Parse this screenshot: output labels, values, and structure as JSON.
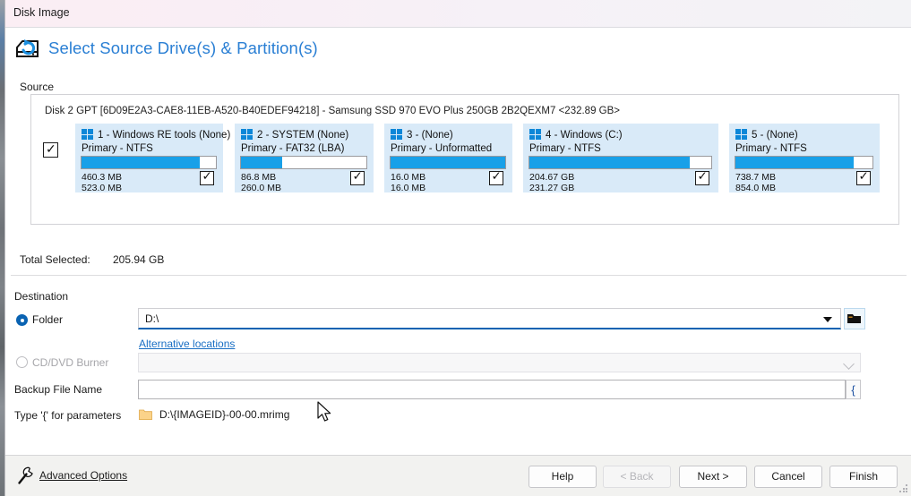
{
  "window": {
    "title": "Disk Image"
  },
  "header": {
    "title": "Select Source Drive(s) & Partition(s)",
    "icon": "disk-image-icon"
  },
  "source": {
    "group_label": "Source",
    "disk_line": "Disk 2 GPT [6D09E2A3-CAE8-11EB-A520-B40EDEF94218] - Samsung SSD 970 EVO Plus 250GB 2B2QEXM7  <232.89 GB>",
    "disk_checked": true,
    "partitions": [
      {
        "title": "1 - Windows RE tools (None)",
        "subtitle": "Primary - NTFS",
        "used": "460.3 MB",
        "total": "523.0 MB",
        "fill_pct": 88,
        "checked": true
      },
      {
        "title": "2 - SYSTEM (None)",
        "subtitle": "Primary - FAT32 (LBA)",
        "used": "86.8 MB",
        "total": "260.0 MB",
        "fill_pct": 33,
        "checked": true
      },
      {
        "title": "3 -  (None)",
        "subtitle": "Primary - Unformatted",
        "used": "16.0 MB",
        "total": "16.0 MB",
        "fill_pct": 100,
        "checked": true
      },
      {
        "title": "4 - Windows (C:)",
        "subtitle": "Primary - NTFS",
        "used": "204.67 GB",
        "total": "231.27 GB",
        "fill_pct": 88,
        "checked": true
      },
      {
        "title": "5 -  (None)",
        "subtitle": "Primary - NTFS",
        "used": "738.7 MB",
        "total": "854.0 MB",
        "fill_pct": 86,
        "checked": true
      }
    ]
  },
  "total": {
    "label": "Total Selected:",
    "value": "205.94 GB"
  },
  "destination": {
    "group_label": "Destination",
    "folder_label": "Folder",
    "folder_selected": true,
    "folder_value": "D:\\",
    "alternative_locations_link": "Alternative locations",
    "cd_label": "CD/DVD Burner",
    "cd_value": "",
    "backup_file_name_label": "Backup File Name",
    "backup_file_name_value": "",
    "brace_button_label": "{",
    "type_hint_label": "Type '{' for parameters",
    "path_sample": "D:\\{IMAGEID}-00-00.mrimg"
  },
  "footer": {
    "advanced_options": "Advanced Options",
    "buttons": [
      {
        "label": "Help",
        "disabled": false
      },
      {
        "label": "< Back",
        "disabled": true
      },
      {
        "label": "Next >",
        "disabled": false
      },
      {
        "label": "Cancel",
        "disabled": false
      },
      {
        "label": "Finish",
        "disabled": false
      }
    ]
  },
  "colors": {
    "accent": "#2a7fd4",
    "bar_fill": "#18a0e8",
    "tile_bg": "#d9eaf8",
    "link": "#1a6fc4"
  }
}
